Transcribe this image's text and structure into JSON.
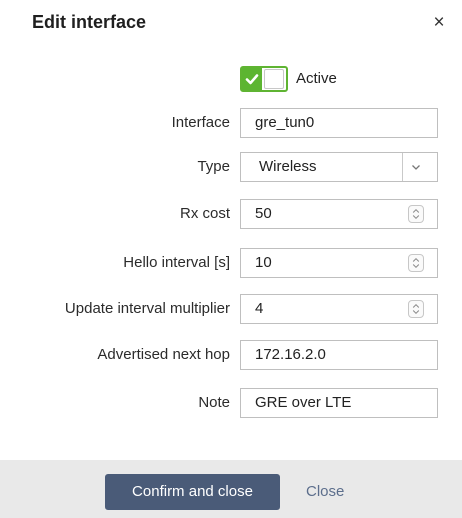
{
  "dialog": {
    "title": "Edit interface",
    "close_glyph": "×"
  },
  "active_toggle": {
    "label": "Active",
    "checked": true,
    "color": "#5cb531"
  },
  "form": {
    "interface": {
      "label": "Interface",
      "value": "gre_tun0"
    },
    "type": {
      "label": "Type",
      "value": "Wireless"
    },
    "rx_cost": {
      "label": "Rx cost",
      "value": "50"
    },
    "hello_interval": {
      "label": "Hello interval [s]",
      "value": "10"
    },
    "update_multiplier": {
      "label": "Update interval multiplier",
      "value": "4"
    },
    "next_hop": {
      "label": "Advertised next hop",
      "value": "172.16.2.0"
    },
    "note": {
      "label": "Note",
      "value": "GRE over LTE"
    }
  },
  "footer": {
    "confirm_label": "Confirm and close",
    "close_label": "Close",
    "confirm_color": "#4a5b78"
  }
}
